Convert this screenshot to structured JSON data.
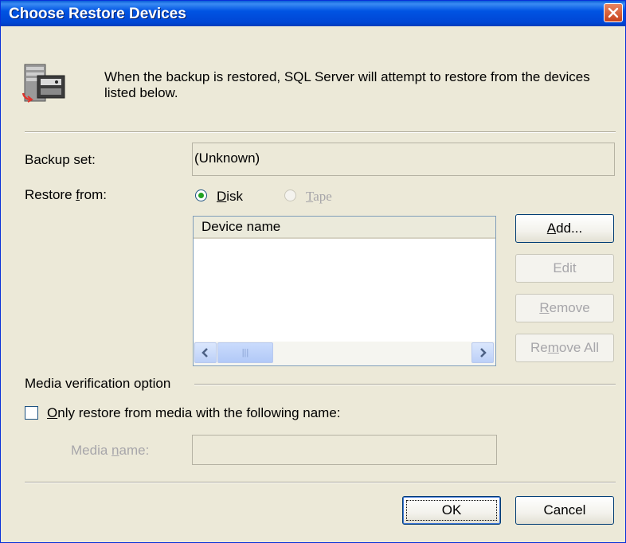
{
  "window": {
    "title": "Choose Restore Devices",
    "intro_text": "When the backup is restored, SQL Server will attempt to restore from the devices listed below."
  },
  "backup_set": {
    "label": "Backup set:",
    "value": "(Unknown)"
  },
  "restore_from": {
    "label_pre": "Restore ",
    "label_key": "f",
    "label_post": "rom:",
    "options": [
      {
        "key": "D",
        "rest": "isk",
        "selected": true,
        "enabled": true
      },
      {
        "key": "T",
        "rest": "ape",
        "selected": false,
        "enabled": false
      }
    ]
  },
  "device_list": {
    "column_header": "Device name",
    "rows": []
  },
  "side_buttons": {
    "add": {
      "key": "A",
      "rest": "dd..."
    },
    "edit": "Edit",
    "remove": {
      "key": "R",
      "rest": "emove"
    },
    "remove_all": {
      "pre": "Re",
      "key": "m",
      "post": "ove All"
    }
  },
  "media_verification": {
    "group_label": "Media verification option",
    "checkbox": {
      "key": "O",
      "rest": "nly restore from media with the following name:",
      "checked": false
    },
    "media_name_label": {
      "pre": "Media ",
      "key": "n",
      "post": "ame:"
    },
    "media_name_value": ""
  },
  "footer": {
    "ok_label": "OK",
    "cancel_label": "Cancel"
  },
  "colors": {
    "titlebar": "#0054e3",
    "dialog_bg": "#ece9d8",
    "disabled_text": "#a7a6aa",
    "radio_dot": "#21a121"
  },
  "icons": [
    "server-restore-icon",
    "close-icon",
    "scroll-left-icon",
    "scroll-right-icon",
    "scroll-grip-icon"
  ]
}
